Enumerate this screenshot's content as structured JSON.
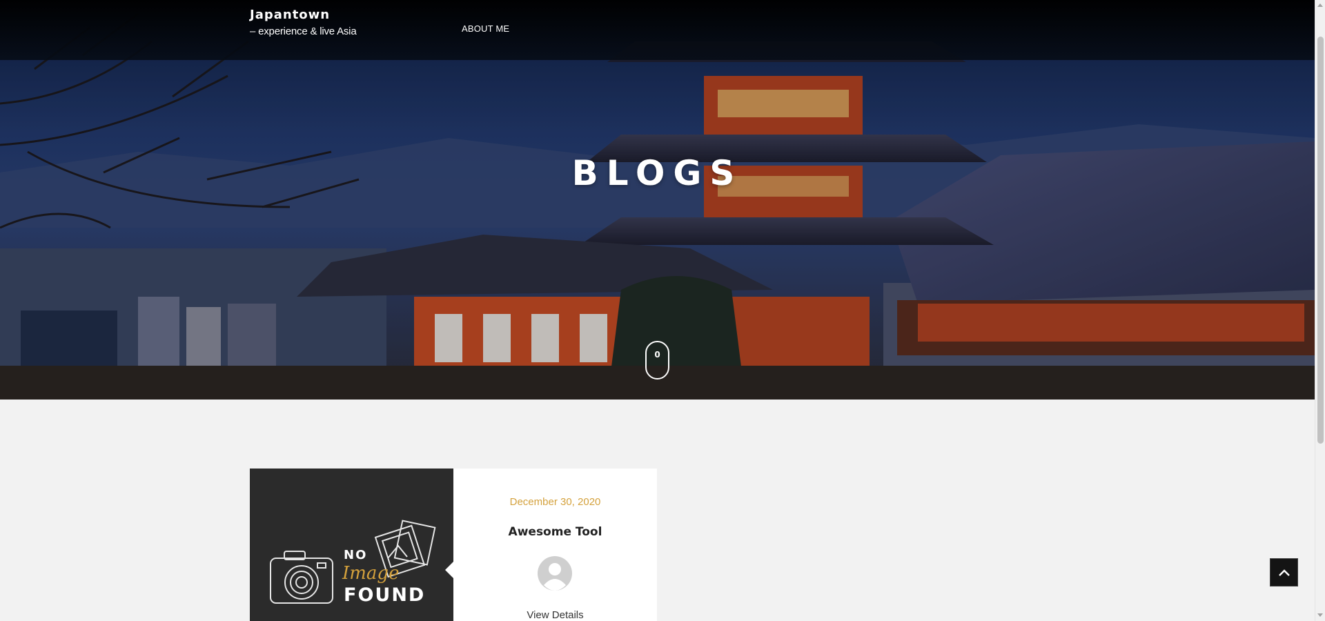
{
  "header": {
    "brand_title": "Japantown",
    "brand_tagline": "– experience & live Asia",
    "nav": [
      {
        "label": "ABOUT ME"
      }
    ]
  },
  "hero": {
    "heading": "BLOGS",
    "scroll_indicator_text": "0",
    "background_icon": "pagoda-temple-photo"
  },
  "posts": [
    {
      "date": "December 30, 2020",
      "title": "Awesome Tool",
      "link_label": "View Details",
      "image": {
        "line1": "NO",
        "line2": "Image",
        "line3": "FOUND"
      },
      "avatar_icon": "user-avatar-icon"
    }
  ],
  "back_to_top_icon": "chevron-up-icon",
  "colors": {
    "accent": "#d4a13c",
    "header_bg": "#000000",
    "page_bg": "#f2f2f2",
    "card_image_bg": "#2b2b2b"
  }
}
